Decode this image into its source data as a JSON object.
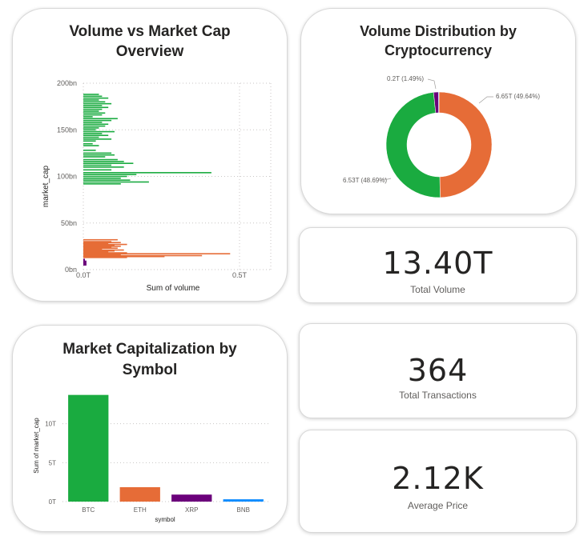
{
  "cards": {
    "volume_market_cap": {
      "title_line1": "Volume vs Market Cap",
      "title_line2": "Overview"
    },
    "volume_distribution": {
      "title_line1": "Volume Distribution by",
      "title_line2": "Cryptocurrency"
    },
    "market_cap_symbol": {
      "title_line1": "Market Capitalization by",
      "title_line2": "Symbol"
    }
  },
  "kpis": [
    {
      "value": "13.40T",
      "label": "Total Volume"
    },
    {
      "value": "364",
      "label": "Total Transactions"
    },
    {
      "value": "2.12K",
      "label": "Average Price"
    }
  ],
  "colors": {
    "btc": "#1aab40",
    "eth": "#e66c37",
    "xrp": "#6b007b",
    "bnb": "#118dff",
    "grid": "#c8c6c4",
    "axis_text": "#605e5c"
  },
  "chart_data": [
    {
      "type": "bar",
      "orientation": "horizontal",
      "xlabel": "Sum of volume",
      "ylabel": "market_cap",
      "x_ticks": [
        "0.0T",
        "0.5T"
      ],
      "y_ticks": [
        "0bn",
        "50bn",
        "100bn",
        "150bn",
        "200bn"
      ],
      "xlim": [
        0,
        0.6
      ],
      "ylim": [
        0,
        200
      ],
      "units": {
        "x": "T",
        "y": "bn"
      },
      "series": [
        {
          "key": "btc",
          "points": [
            {
              "y": 188,
              "x": 0.05
            },
            {
              "y": 186,
              "x": 0.06
            },
            {
              "y": 184,
              "x": 0.08
            },
            {
              "y": 182,
              "x": 0.05
            },
            {
              "y": 180,
              "x": 0.07
            },
            {
              "y": 178,
              "x": 0.09
            },
            {
              "y": 176,
              "x": 0.06
            },
            {
              "y": 174,
              "x": 0.08
            },
            {
              "y": 172,
              "x": 0.06
            },
            {
              "y": 170,
              "x": 0.05
            },
            {
              "y": 168,
              "x": 0.07
            },
            {
              "y": 166,
              "x": 0.06
            },
            {
              "y": 164,
              "x": 0.03
            },
            {
              "y": 162,
              "x": 0.11
            },
            {
              "y": 160,
              "x": 0.09
            },
            {
              "y": 158,
              "x": 0.06
            },
            {
              "y": 156,
              "x": 0.08
            },
            {
              "y": 154,
              "x": 0.07
            },
            {
              "y": 152,
              "x": 0.05
            },
            {
              "y": 150,
              "x": 0.04
            },
            {
              "y": 148,
              "x": 0.1
            },
            {
              "y": 146,
              "x": 0.06
            },
            {
              "y": 144,
              "x": 0.08
            },
            {
              "y": 142,
              "x": 0.05
            },
            {
              "y": 140,
              "x": 0.09
            },
            {
              "y": 138,
              "x": 0.04
            },
            {
              "y": 135,
              "x": 0.03
            },
            {
              "y": 133,
              "x": 0.05
            },
            {
              "y": 128,
              "x": 0.04
            },
            {
              "y": 125,
              "x": 0.09
            },
            {
              "y": 123,
              "x": 0.1
            },
            {
              "y": 121,
              "x": 0.07
            },
            {
              "y": 118,
              "x": 0.11
            },
            {
              "y": 116,
              "x": 0.13
            },
            {
              "y": 114,
              "x": 0.16
            },
            {
              "y": 112,
              "x": 0.09
            },
            {
              "y": 110,
              "x": 0.13
            },
            {
              "y": 107,
              "x": 0.09
            },
            {
              "y": 104,
              "x": 0.41
            },
            {
              "y": 102,
              "x": 0.17
            },
            {
              "y": 100,
              "x": 0.14
            },
            {
              "y": 98,
              "x": 0.12
            },
            {
              "y": 96,
              "x": 0.15
            },
            {
              "y": 94,
              "x": 0.21
            },
            {
              "y": 92,
              "x": 0.12
            }
          ]
        },
        {
          "key": "eth",
          "points": [
            {
              "y": 32,
              "x": 0.11
            },
            {
              "y": 30,
              "x": 0.09
            },
            {
              "y": 29,
              "x": 0.12
            },
            {
              "y": 28,
              "x": 0.08
            },
            {
              "y": 27,
              "x": 0.14
            },
            {
              "y": 26,
              "x": 0.1
            },
            {
              "y": 25,
              "x": 0.12
            },
            {
              "y": 24,
              "x": 0.09
            },
            {
              "y": 23,
              "x": 0.11
            },
            {
              "y": 22,
              "x": 0.06
            },
            {
              "y": 21,
              "x": 0.13
            },
            {
              "y": 20,
              "x": 0.1
            },
            {
              "y": 19,
              "x": 0.08
            },
            {
              "y": 18,
              "x": 0.14
            },
            {
              "y": 17,
              "x": 0.47
            },
            {
              "y": 16,
              "x": 0.12
            },
            {
              "y": 15,
              "x": 0.38
            },
            {
              "y": 14,
              "x": 0.26
            },
            {
              "y": 13,
              "x": 0.14
            }
          ]
        },
        {
          "key": "xrp",
          "points": [
            {
              "y": 11,
              "x": 0.005
            },
            {
              "y": 10,
              "x": 0.005
            },
            {
              "y": 9,
              "x": 0.01
            },
            {
              "y": 8,
              "x": 0.01
            },
            {
              "y": 7,
              "x": 0.01
            },
            {
              "y": 6,
              "x": 0.01
            },
            {
              "y": 5,
              "x": 0.01
            }
          ]
        }
      ]
    },
    {
      "type": "pie",
      "variant": "donut",
      "slices": [
        {
          "key": "eth",
          "value": 6.65,
          "label": "6.65T (49.64%)",
          "percent": 49.64
        },
        {
          "key": "btc",
          "value": 6.53,
          "label": "6.53T (48.69%)",
          "percent": 48.69
        },
        {
          "key": "xrp",
          "value": 0.2,
          "label": "0.2T (1.49%)",
          "percent": 1.49
        },
        {
          "key": "bnb",
          "value": 0.02,
          "label": "",
          "percent": 0.18
        }
      ]
    },
    {
      "type": "bar",
      "categories": [
        "BTC",
        "ETH",
        "XRP",
        "BNB"
      ],
      "keys": [
        "btc",
        "eth",
        "xrp",
        "bnb"
      ],
      "values": [
        13.7,
        1.85,
        0.9,
        0.3
      ],
      "xlabel": "symbol",
      "ylabel": "Sum of market_cap",
      "y_ticks": [
        "0T",
        "5T",
        "10T"
      ],
      "ylim": [
        0,
        15
      ],
      "units": "T"
    }
  ]
}
